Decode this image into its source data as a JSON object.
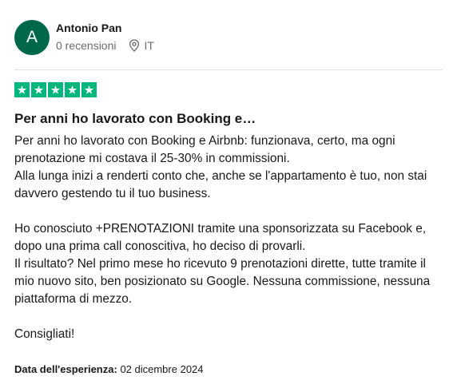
{
  "reviewer": {
    "avatar_initial": "A",
    "avatar_color": "#00684a",
    "name": "Antonio Pan",
    "reviews_count": "0 recensioni",
    "country": "IT",
    "location_icon": "map-pin-icon"
  },
  "review": {
    "rating": 5,
    "rating_max": 5,
    "star_color": "#00b67a",
    "title": "Per anni ho lavorato con Booking e…",
    "paragraphs": [
      "Per anni ho lavorato con Booking e Airbnb: funzionava, certo, ma ogni prenotazione mi costava il 25-30% in commissioni.\nAlla lunga inizi a renderti conto che, anche se l'appartamento è tuo, non stai davvero gestendo tu il tuo business.",
      "Ho conosciuto +PRENOTAZIONI tramite una sponsorizzata su Facebook e, dopo una prima call conoscitiva, ho deciso di provarli.\nIl risultato? Nel primo mese ho ricevuto 9 prenotazioni dirette, tutte tramite il mio nuovo sito, ben posizionato su Google. Nessuna commissione, nessuna piattaforma di mezzo.",
      "Consigliati!"
    ],
    "experience_label": "Data dell'esperienza:",
    "experience_date": "02 dicembre 2024"
  }
}
